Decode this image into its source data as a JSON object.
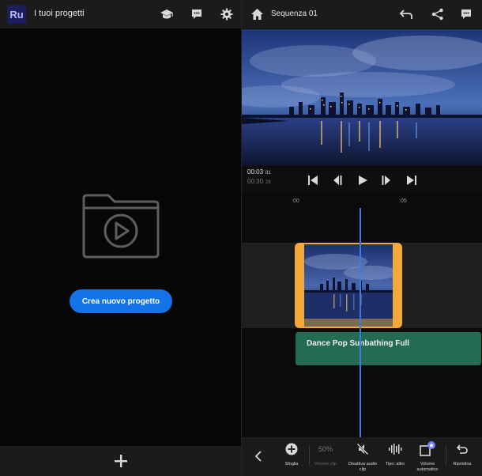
{
  "left": {
    "app_logo": "Ru",
    "title": "I tuoi progetti",
    "header_icons": [
      "learn-icon",
      "feedback-icon",
      "settings-icon"
    ],
    "create_button": "Crea nuovo progetto",
    "footer_icon": "plus-icon"
  },
  "right": {
    "header_icon_left": "home-icon",
    "sequence_title": "Sequenza 01",
    "header_icons_right": [
      "undo-icon",
      "share-icon",
      "comment-icon"
    ],
    "timecode_current": "00:03",
    "timecode_current_frame": "01",
    "timecode_duration": "00:30",
    "timecode_duration_frame": "28",
    "playback_icons": [
      "skip-to-start-icon",
      "step-back-icon",
      "play-icon",
      "step-forward-icon",
      "skip-to-end-icon"
    ],
    "ruler_marks": [
      ":00",
      ":05"
    ],
    "audio_clip_label": "Dance Pop Sunbathing Full",
    "toolbar": {
      "tools": [
        {
          "icon": "add-circle-icon",
          "label": "Sfoglia",
          "enabled": true
        },
        {
          "icon": "volume-percent",
          "value": "50%",
          "label": "Volume clip",
          "enabled": false
        },
        {
          "icon": "mute-audio-icon",
          "label": "Disattiva audio clip",
          "enabled": true
        },
        {
          "icon": "waveform-icon",
          "label": "Tipo: altro",
          "enabled": true
        },
        {
          "icon": "auto-volume-icon",
          "label": "Volume automatico",
          "enabled": true
        },
        {
          "icon": "reset-icon",
          "label": "Ripristina",
          "enabled": true
        }
      ]
    }
  },
  "colors": {
    "accent_blue": "#1473e6",
    "playhead": "#3b7be8",
    "clip_selected": "#f4a83a",
    "audio_clip": "#236b54"
  }
}
